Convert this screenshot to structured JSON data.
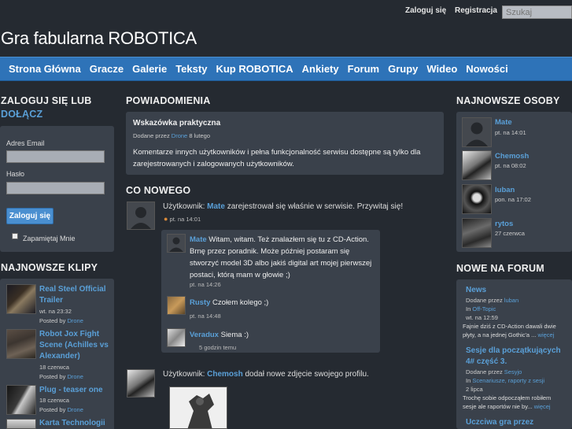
{
  "header": {
    "login_link": "Zaloguj się",
    "register_link": "Registracja",
    "search_placeholder": "Szukaj",
    "site_title": "Gra fabularna ROBOTICA"
  },
  "nav": [
    "Strona Główna",
    "Gracze",
    "Galerie",
    "Teksty",
    "Kup ROBOTICA",
    "Ankiety",
    "Forum",
    "Grupy",
    "Wideo",
    "Nowości"
  ],
  "login": {
    "heading_line1": "ZALOGUJ SIĘ LUB",
    "heading_link": "DOŁĄCZ",
    "email_label": "Adres Email",
    "password_label": "Hasło",
    "submit_label": "Zaloguj się",
    "remember_label": "Zapamiętaj Mnie"
  },
  "clips": {
    "heading": "NAJNOWSZE KLIPY",
    "items": [
      {
        "title": "Real Steel Official Trailer",
        "date": "wt. na 23:32",
        "posted_prefix": "Posted by",
        "author": "Drone"
      },
      {
        "title": "Robot Jox Fight Scene (Achilles vs Alexander)",
        "date": "18 czerwca",
        "posted_prefix": "Posted by",
        "author": "Drone"
      },
      {
        "title": "Plug - teaser one",
        "date": "18 czerwca",
        "posted_prefix": "Posted by",
        "author": "Drone"
      },
      {
        "title": "Karta Technologii",
        "date": "",
        "posted_prefix": "",
        "author": ""
      }
    ]
  },
  "notifications": {
    "heading": "POWIADOMIENIA",
    "hint_title": "Wskazówka praktyczna",
    "hint_meta_prefix": "Dodane przez",
    "hint_author": "Drone",
    "hint_date": "8 lutego",
    "hint_body": "Komentarze innych użytkowników i pełna funkcjonalność serwisu dostępne są tylko dla zarejestrowanych i zalogowanych użytkowników."
  },
  "feed": {
    "heading": "CO NOWEGO",
    "item1": {
      "prefix": "Użytkownik:",
      "user": "Mate",
      "text": "zarejestrował się właśnie w serwisie. Przywitaj się!",
      "time": "pt. na 14:01"
    },
    "comments": [
      {
        "user": "Mate",
        "text": "Witam, witam. Też znalazłem się tu z CD-Action. Brnę przez poradnik. Może później postaram się stworzyć model 3D albo jakiś digital art mojej pierwszej postaci, którą mam w głowie ;)",
        "time": "pt. na 14:26"
      },
      {
        "user": "Rusty",
        "text": "Czołem kolego ;)",
        "time": "pt. na 14:48"
      },
      {
        "user": "Veradux",
        "text": "Siema :)",
        "time": "5 godzin temu"
      }
    ],
    "item2": {
      "prefix": "Użytkownik:",
      "user": "Chemosh",
      "text": "dodał nowe zdjęcie swojego profilu."
    }
  },
  "users": {
    "heading": "NAJNOWSZE OSOBY",
    "items": [
      {
        "name": "Mate",
        "date": "pt. na 14:01"
      },
      {
        "name": "Chemosh",
        "date": "pt. na 08:02"
      },
      {
        "name": "luban",
        "date": "pon. na 17:02"
      },
      {
        "name": "rytos",
        "date": "27 czerwca"
      }
    ]
  },
  "forum": {
    "heading": "NOWE NA FORUM",
    "items": [
      {
        "title": "News",
        "added_prefix": "Dodane przez",
        "author": "luban",
        "in_prefix": "In",
        "category": "Off-Topic",
        "date": "wt. na 12:59",
        "excerpt": "Fajnie dziś z CD-Action dawali dwie płyty, a na jednej Gothic'a ...",
        "more": "więcej"
      },
      {
        "title": "Sesje dla początkujących 4# część 3.",
        "added_prefix": "Dodane przez",
        "author": "Sesyjo",
        "in_prefix": "In",
        "category": "Scenariusze, raporty z sesji",
        "date": "2 lipca",
        "excerpt": "Trochę sobie odpocząłem robiłem sesje ale raportów nie by...",
        "more": "więcej"
      },
      {
        "title": "Uczciwa gra przez",
        "added_prefix": "",
        "author": "",
        "in_prefix": "",
        "category": "",
        "date": "",
        "excerpt": "",
        "more": ""
      }
    ]
  }
}
